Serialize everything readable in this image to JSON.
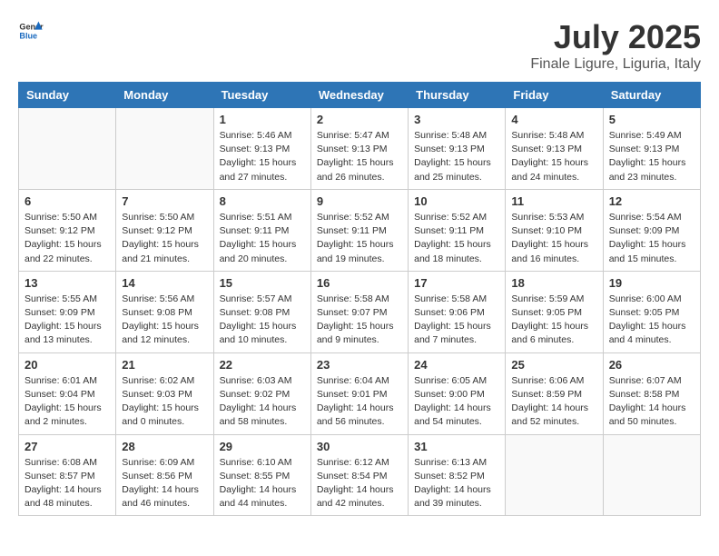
{
  "logo": {
    "text_general": "General",
    "text_blue": "Blue"
  },
  "header": {
    "month": "July 2025",
    "location": "Finale Ligure, Liguria, Italy"
  },
  "weekdays": [
    "Sunday",
    "Monday",
    "Tuesday",
    "Wednesday",
    "Thursday",
    "Friday",
    "Saturday"
  ],
  "weeks": [
    [
      {
        "day": "",
        "info": ""
      },
      {
        "day": "",
        "info": ""
      },
      {
        "day": "1",
        "info": "Sunrise: 5:46 AM\nSunset: 9:13 PM\nDaylight: 15 hours\nand 27 minutes."
      },
      {
        "day": "2",
        "info": "Sunrise: 5:47 AM\nSunset: 9:13 PM\nDaylight: 15 hours\nand 26 minutes."
      },
      {
        "day": "3",
        "info": "Sunrise: 5:48 AM\nSunset: 9:13 PM\nDaylight: 15 hours\nand 25 minutes."
      },
      {
        "day": "4",
        "info": "Sunrise: 5:48 AM\nSunset: 9:13 PM\nDaylight: 15 hours\nand 24 minutes."
      },
      {
        "day": "5",
        "info": "Sunrise: 5:49 AM\nSunset: 9:13 PM\nDaylight: 15 hours\nand 23 minutes."
      }
    ],
    [
      {
        "day": "6",
        "info": "Sunrise: 5:50 AM\nSunset: 9:12 PM\nDaylight: 15 hours\nand 22 minutes."
      },
      {
        "day": "7",
        "info": "Sunrise: 5:50 AM\nSunset: 9:12 PM\nDaylight: 15 hours\nand 21 minutes."
      },
      {
        "day": "8",
        "info": "Sunrise: 5:51 AM\nSunset: 9:11 PM\nDaylight: 15 hours\nand 20 minutes."
      },
      {
        "day": "9",
        "info": "Sunrise: 5:52 AM\nSunset: 9:11 PM\nDaylight: 15 hours\nand 19 minutes."
      },
      {
        "day": "10",
        "info": "Sunrise: 5:52 AM\nSunset: 9:11 PM\nDaylight: 15 hours\nand 18 minutes."
      },
      {
        "day": "11",
        "info": "Sunrise: 5:53 AM\nSunset: 9:10 PM\nDaylight: 15 hours\nand 16 minutes."
      },
      {
        "day": "12",
        "info": "Sunrise: 5:54 AM\nSunset: 9:09 PM\nDaylight: 15 hours\nand 15 minutes."
      }
    ],
    [
      {
        "day": "13",
        "info": "Sunrise: 5:55 AM\nSunset: 9:09 PM\nDaylight: 15 hours\nand 13 minutes."
      },
      {
        "day": "14",
        "info": "Sunrise: 5:56 AM\nSunset: 9:08 PM\nDaylight: 15 hours\nand 12 minutes."
      },
      {
        "day": "15",
        "info": "Sunrise: 5:57 AM\nSunset: 9:08 PM\nDaylight: 15 hours\nand 10 minutes."
      },
      {
        "day": "16",
        "info": "Sunrise: 5:58 AM\nSunset: 9:07 PM\nDaylight: 15 hours\nand 9 minutes."
      },
      {
        "day": "17",
        "info": "Sunrise: 5:58 AM\nSunset: 9:06 PM\nDaylight: 15 hours\nand 7 minutes."
      },
      {
        "day": "18",
        "info": "Sunrise: 5:59 AM\nSunset: 9:05 PM\nDaylight: 15 hours\nand 6 minutes."
      },
      {
        "day": "19",
        "info": "Sunrise: 6:00 AM\nSunset: 9:05 PM\nDaylight: 15 hours\nand 4 minutes."
      }
    ],
    [
      {
        "day": "20",
        "info": "Sunrise: 6:01 AM\nSunset: 9:04 PM\nDaylight: 15 hours\nand 2 minutes."
      },
      {
        "day": "21",
        "info": "Sunrise: 6:02 AM\nSunset: 9:03 PM\nDaylight: 15 hours\nand 0 minutes."
      },
      {
        "day": "22",
        "info": "Sunrise: 6:03 AM\nSunset: 9:02 PM\nDaylight: 14 hours\nand 58 minutes."
      },
      {
        "day": "23",
        "info": "Sunrise: 6:04 AM\nSunset: 9:01 PM\nDaylight: 14 hours\nand 56 minutes."
      },
      {
        "day": "24",
        "info": "Sunrise: 6:05 AM\nSunset: 9:00 PM\nDaylight: 14 hours\nand 54 minutes."
      },
      {
        "day": "25",
        "info": "Sunrise: 6:06 AM\nSunset: 8:59 PM\nDaylight: 14 hours\nand 52 minutes."
      },
      {
        "day": "26",
        "info": "Sunrise: 6:07 AM\nSunset: 8:58 PM\nDaylight: 14 hours\nand 50 minutes."
      }
    ],
    [
      {
        "day": "27",
        "info": "Sunrise: 6:08 AM\nSunset: 8:57 PM\nDaylight: 14 hours\nand 48 minutes."
      },
      {
        "day": "28",
        "info": "Sunrise: 6:09 AM\nSunset: 8:56 PM\nDaylight: 14 hours\nand 46 minutes."
      },
      {
        "day": "29",
        "info": "Sunrise: 6:10 AM\nSunset: 8:55 PM\nDaylight: 14 hours\nand 44 minutes."
      },
      {
        "day": "30",
        "info": "Sunrise: 6:12 AM\nSunset: 8:54 PM\nDaylight: 14 hours\nand 42 minutes."
      },
      {
        "day": "31",
        "info": "Sunrise: 6:13 AM\nSunset: 8:52 PM\nDaylight: 14 hours\nand 39 minutes."
      },
      {
        "day": "",
        "info": ""
      },
      {
        "day": "",
        "info": ""
      }
    ]
  ]
}
